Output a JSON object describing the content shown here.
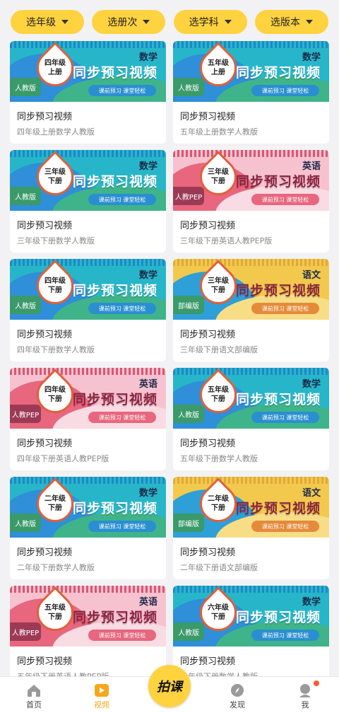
{
  "filters": [
    {
      "label": "选年级"
    },
    {
      "label": "选册次"
    },
    {
      "label": "选学科"
    },
    {
      "label": "选版本"
    }
  ],
  "banner_common": {
    "title": "同步预习视频",
    "slogan": "课前预习 课堂轻松"
  },
  "cards": [
    {
      "grade": "四年级",
      "term": "上册",
      "subject": "数学",
      "edition": "人教版",
      "theme": "blue",
      "title": "同步预习视频",
      "subtitle": "四年级上册数学人教版"
    },
    {
      "grade": "五年级",
      "term": "上册",
      "subject": "数学",
      "edition": "人教版",
      "theme": "blue",
      "title": "同步预习视频",
      "subtitle": "五年级上册数学人教版"
    },
    {
      "grade": "三年级",
      "term": "下册",
      "subject": "数学",
      "edition": "人教版",
      "theme": "blue",
      "title": "同步预习视频",
      "subtitle": "三年级下册数学人教版"
    },
    {
      "grade": "三年级",
      "term": "下册",
      "subject": "英语",
      "edition": "人教PEP",
      "theme": "pink",
      "title": "同步预习视频",
      "subtitle": "三年级下册英语人教PEP版"
    },
    {
      "grade": "四年级",
      "term": "下册",
      "subject": "数学",
      "edition": "人教版",
      "theme": "blue",
      "title": "同步预习视频",
      "subtitle": "四年级下册数学人教版"
    },
    {
      "grade": "三年级",
      "term": "下册",
      "subject": "语文",
      "edition": "部编版",
      "theme": "yellow",
      "title": "同步预习视频",
      "subtitle": "三年级下册语文部编版"
    },
    {
      "grade": "四年级",
      "term": "下册",
      "subject": "英语",
      "edition": "人教PEP",
      "theme": "pink",
      "title": "同步预习视频",
      "subtitle": "四年级下册英语人教PEP版"
    },
    {
      "grade": "五年级",
      "term": "下册",
      "subject": "数学",
      "edition": "人教版",
      "theme": "blue",
      "title": "同步预习视频",
      "subtitle": "五年级下册数学人教版"
    },
    {
      "grade": "二年级",
      "term": "下册",
      "subject": "数学",
      "edition": "人教版",
      "theme": "blue",
      "title": "同步预习视频",
      "subtitle": "二年级下册数学人教版"
    },
    {
      "grade": "二年级",
      "term": "下册",
      "subject": "语文",
      "edition": "部编版",
      "theme": "yellow",
      "title": "同步预习视频",
      "subtitle": "二年级下册语文部编版"
    },
    {
      "grade": "五年级",
      "term": "下册",
      "subject": "英语",
      "edition": "人教PEP",
      "theme": "pink",
      "title": "同步预习视频",
      "subtitle": "五年级下册英语人教PEP版"
    },
    {
      "grade": "六年级",
      "term": "下册",
      "subject": "数学",
      "edition": "人教版",
      "theme": "blue",
      "title": "同步预习视频",
      "subtitle": "六年级下册数学人教版"
    }
  ],
  "themes": {
    "blue": {
      "bg": "#27b6c9",
      "blob1": "#2f8fd8",
      "blob2": "#3fb48a",
      "stripe": "#1e88c8",
      "tag": "#3a9a6a",
      "pill": "#2a8fd0",
      "leaf_border": "#e0603a"
    },
    "pink": {
      "bg": "#f7c2cf",
      "blob1": "#e8667e",
      "blob2": "#f9dbe3",
      "stripe": "#d85773",
      "tag": "#9c3a55",
      "pill": "#e8667e",
      "leaf_border": "#e0603a"
    },
    "yellow": {
      "bg": "#f2c94c",
      "blob1": "#2f9fd8",
      "blob2": "#f7de86",
      "stripe": "#e0a93a",
      "tag": "#3a9a6a",
      "pill": "#e58a3a",
      "leaf_border": "#e0603a"
    }
  },
  "nav": {
    "home": "首页",
    "video": "视频",
    "center": "拍课",
    "discover": "发现",
    "me": "我"
  },
  "colors": {
    "accent": "#ffd23f",
    "active": "#f6a81a",
    "badge": "#ff5a2c"
  }
}
